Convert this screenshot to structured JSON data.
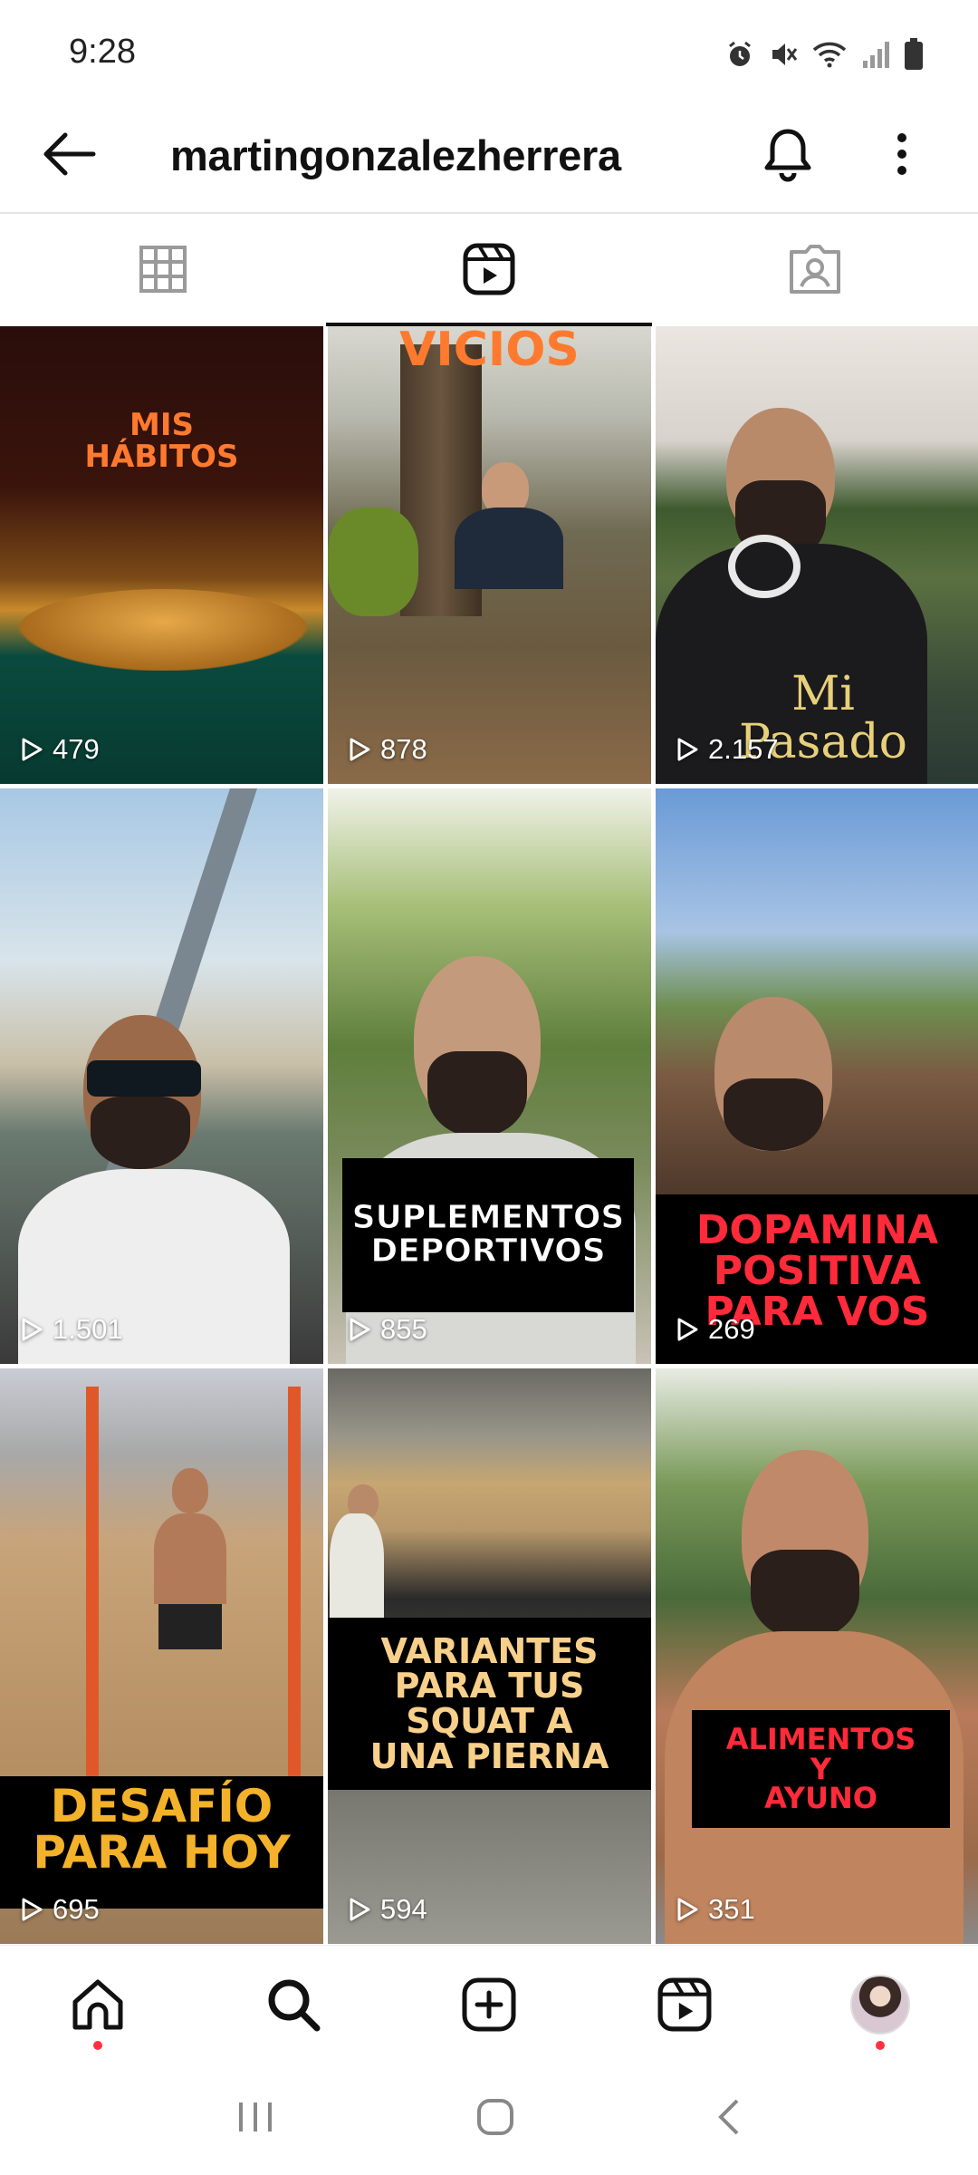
{
  "status_bar": {
    "time": "9:28"
  },
  "header": {
    "username": "martingonzalezherrera"
  },
  "tabs": [
    {
      "name": "grid",
      "icon": "grid-icon",
      "active": false
    },
    {
      "name": "reels",
      "icon": "reels-icon",
      "active": true
    },
    {
      "name": "tagged",
      "icon": "tagged-icon",
      "active": false
    }
  ],
  "reels": [
    {
      "overlay": "MIS\nHÁBITOS",
      "views": "479"
    },
    {
      "overlay": "VICIOS",
      "views": "878"
    },
    {
      "overlay": "Mi\nPasado",
      "views": "2.157"
    },
    {
      "overlay": "",
      "views": "1.501"
    },
    {
      "overlay": "SUPLEMENTOS\nDEPORTIVOS",
      "views": "855"
    },
    {
      "overlay": "DOPAMINA\nPOSITIVA\nPARA VOS",
      "views": "269"
    },
    {
      "overlay": "DESAFÍO\nPARA HOY",
      "views": "695"
    },
    {
      "overlay": "VARIANTES\nPARA TUS\nSQUAT A\nUNA PIERNA",
      "views": "594"
    },
    {
      "overlay": "ALIMENTOS\nY\nAYUNO",
      "views": "351"
    }
  ],
  "bottom_nav": [
    {
      "name": "home",
      "icon": "home-icon",
      "notification_dot": true
    },
    {
      "name": "search",
      "icon": "search-icon",
      "notification_dot": false
    },
    {
      "name": "create",
      "icon": "create-icon",
      "notification_dot": false
    },
    {
      "name": "reels",
      "icon": "reels-icon",
      "notification_dot": false
    },
    {
      "name": "profile",
      "icon": "avatar",
      "notification_dot": true
    }
  ],
  "colors": {
    "accent_dot": "#ff3040",
    "text": "#111111",
    "divider": "#e4e4e4"
  }
}
